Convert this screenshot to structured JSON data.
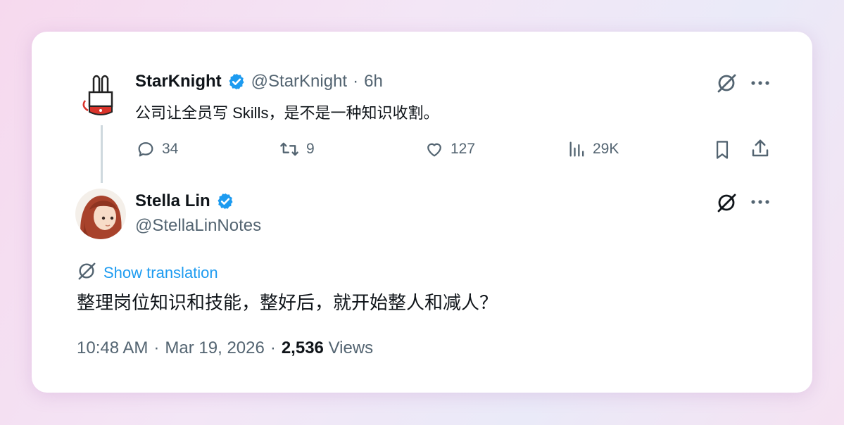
{
  "quoted_tweet": {
    "author_name": "StarKnight",
    "author_handle": "@StarKnight",
    "separator": "·",
    "time_ago": "6h",
    "text": "公司让全员写 Skills，是不是一种知识收割。",
    "metrics": {
      "replies": "34",
      "retweets": "9",
      "likes": "127",
      "views": "29K"
    },
    "icons": [
      "grok-icon",
      "more-icon",
      "reply-icon",
      "retweet-icon",
      "like-icon",
      "views-icon",
      "bookmark-icon",
      "share-icon"
    ]
  },
  "main_tweet": {
    "author_name": "Stella Lin",
    "author_handle": "@StellaLinNotes",
    "translate_label": "Show translation",
    "text": "整理岗位知识和技能，整好后，就开始整人和减人？",
    "time": "10:48 AM",
    "date": "Mar 19, 2026",
    "separator": "·",
    "views_count": "2,536",
    "views_label": "Views"
  },
  "colors": {
    "verified": "#1d9bf0",
    "link": "#1d9bf0",
    "secondary_text": "#536471",
    "primary_text": "#0f1419"
  }
}
